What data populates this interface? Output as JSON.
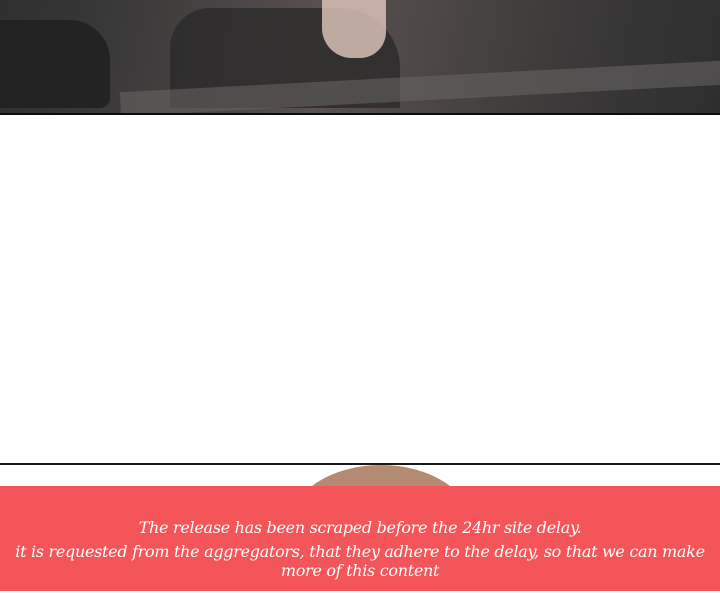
{
  "notice": {
    "line1": "The release has been scraped before the 24hr site delay.",
    "line2": "it is requested from the aggregators, that they adhere to the delay, so that we can make more of this content"
  },
  "colors": {
    "banner_background": "#f35558",
    "banner_text": "#ffffff"
  }
}
